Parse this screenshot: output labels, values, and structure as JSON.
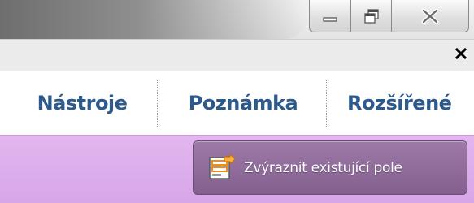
{
  "window": {
    "controls": {
      "minimize_icon": "minimize-icon",
      "maximize_icon": "restore-icon",
      "close_icon": "close-icon"
    }
  },
  "panel": {
    "close_icon": "close-x-icon"
  },
  "tabs": [
    {
      "label": "Nástroje"
    },
    {
      "label": "Poznámka"
    },
    {
      "label": "Rozšířené"
    }
  ],
  "forms_bar": {
    "highlight_button": {
      "label": "Zvýraznit existující pole",
      "icon": "highlight-fields-icon"
    }
  },
  "colors": {
    "tab_text": "#2c5a8c",
    "forms_bar": "#dcaeed",
    "button_bg": "#8e6a99",
    "icon_orange": "#f08c1a"
  }
}
